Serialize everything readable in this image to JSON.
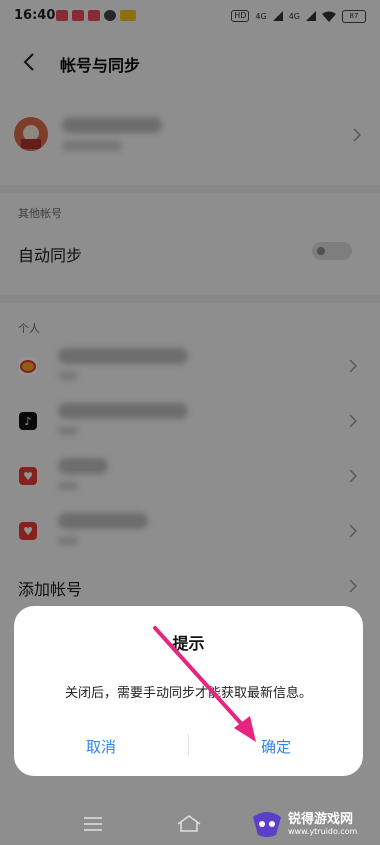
{
  "status": {
    "time": "16:40",
    "net1": "HD",
    "net2": "4G",
    "net3": "4G",
    "battery": "87"
  },
  "header": {
    "title": "帐号与同步"
  },
  "sections": {
    "other_label": "其他帐号",
    "auto_sync_label": "自动同步",
    "personal_label": "个人",
    "add_account_label": "添加帐号"
  },
  "dialog": {
    "title": "提示",
    "message": "关闭后，需要手动同步才能获取最新信息。",
    "cancel": "取消",
    "confirm": "确定"
  },
  "watermark": {
    "name": "锐得游戏网",
    "url": "www.ytruido.com"
  },
  "colors": {
    "dialog_button": "#2f86e8",
    "arrow": "#e8257e",
    "weibo": "#f5a623",
    "tiktok": "#111111",
    "huawei_red": "#e53935"
  }
}
